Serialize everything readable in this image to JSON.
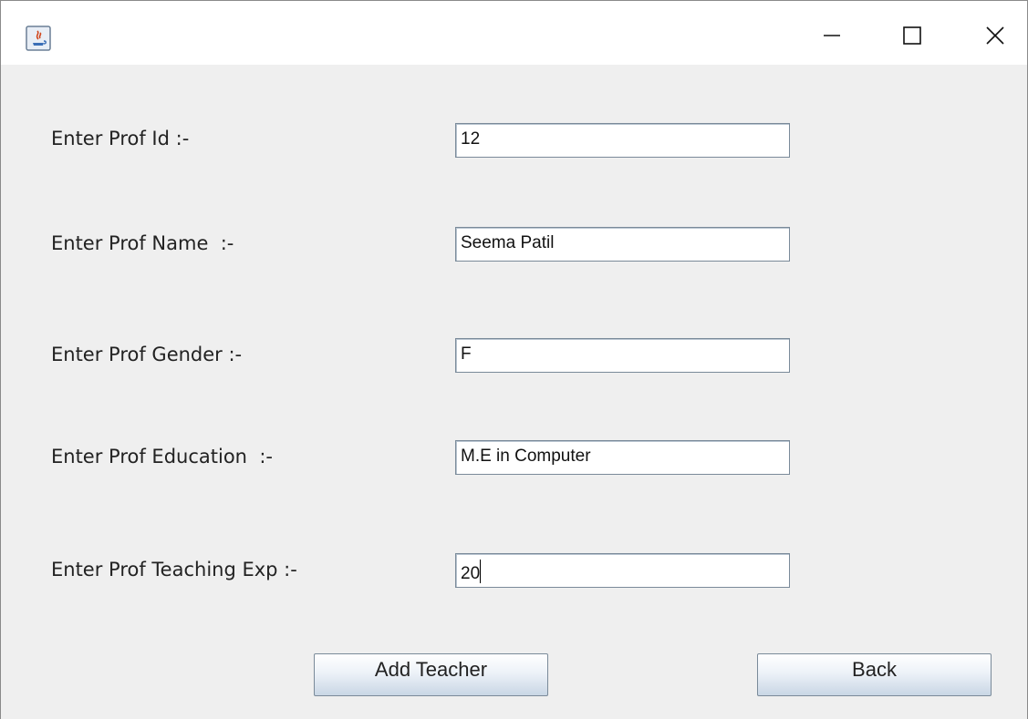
{
  "window": {
    "title": "",
    "controls": {
      "minimize": "minimize-icon",
      "maximize": "maximize-icon",
      "close": "close-icon"
    }
  },
  "form": {
    "fields": [
      {
        "label": "Enter Prof Id :-",
        "value": "12"
      },
      {
        "label": "Enter Prof Name  :-",
        "value": "Seema Patil"
      },
      {
        "label": "Enter Prof Gender :-",
        "value": "F"
      },
      {
        "label": "Enter Prof Education  :-",
        "value": "M.E in Computer"
      },
      {
        "label": "Enter Prof Teaching Exp :-",
        "value": "20"
      }
    ]
  },
  "buttons": {
    "add_label": "Add Teacher",
    "back_label": "Back"
  },
  "colors": {
    "background": "#efefef",
    "titlebar": "#ffffff",
    "field_border": "#7a8a99",
    "button_gradient_top": "#ffffff",
    "button_gradient_bottom": "#c9d6e5"
  }
}
